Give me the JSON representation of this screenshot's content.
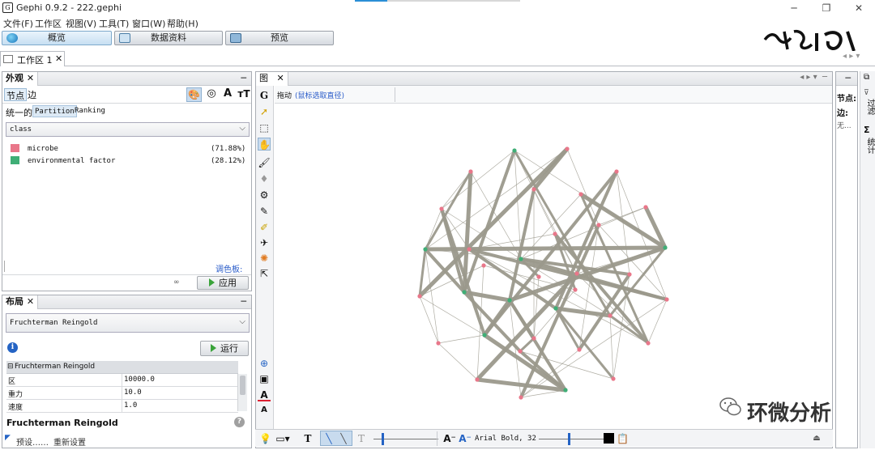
{
  "window": {
    "title": "Gephi 0.9.2 - 222.gephi",
    "app_icon": "gephi-icon"
  },
  "menu": [
    "文件(F)",
    "工作区",
    "视图(V)",
    "工具(T)",
    "窗口(W)",
    "帮助(H)"
  ],
  "modes": [
    {
      "label": "概览",
      "icon": "globe-icon"
    },
    {
      "label": "数据资料",
      "icon": "table-icon"
    },
    {
      "label": "预览",
      "icon": "monitor-icon"
    }
  ],
  "workspace_tab": "工作区 1",
  "appearance": {
    "title": "外观",
    "subtabs": [
      "节点",
      "边"
    ],
    "modes": [
      "统一的",
      "Partition",
      "Ranking"
    ],
    "attribute": "class",
    "partitions": [
      {
        "label": "microbe",
        "pct": "(71.88%)",
        "color": "#e9778a"
      },
      {
        "label": "environmental factor",
        "pct": "(28.12%)",
        "color": "#3fae76"
      }
    ],
    "palette_link": "调色板:",
    "apply": "应用"
  },
  "layout": {
    "title": "布局",
    "algorithm": "Fruchterman Reingold",
    "run": "运行",
    "section": "Fruchterman Reingold",
    "props": [
      {
        "key": "区",
        "value": "10000.0"
      },
      {
        "key": "重力",
        "value": "10.0"
      },
      {
        "key": "速度",
        "value": "1.0"
      }
    ],
    "desc_title": "Fruchterman Reingold",
    "presets": "预设……",
    "reset": "重新设置"
  },
  "graph": {
    "tab": "图",
    "drag_label": "拖动",
    "drag_hint": "(鼠标选取直径)",
    "node_colors": {
      "microbe": "#e9778a",
      "environmental": "#3fae76"
    },
    "edge_color": "#9b998c",
    "font_label": "Arial Bold, 32"
  },
  "context": {
    "nodes": "节点:",
    "edges": "边:",
    "none": "无..."
  },
  "right_rail": {
    "filter": "过滤",
    "stats": "统计"
  },
  "watermark": "环微分析"
}
